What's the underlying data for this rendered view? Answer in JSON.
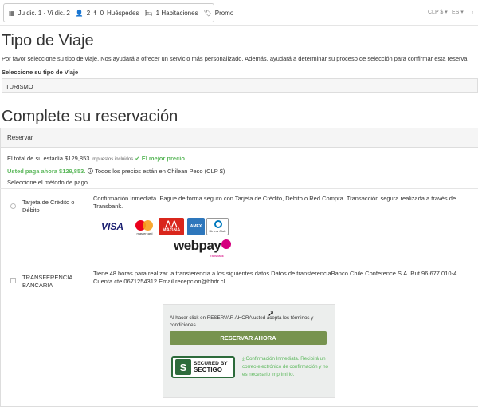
{
  "search": {
    "dates": "Ju dic. 1 - Vi dic. 2",
    "guests": "2",
    "guests_zero": "0",
    "guests_label": "Huéspedes",
    "rooms": "1 Habitaciones",
    "promo": "Promo"
  },
  "header": {
    "currency": "CLP $",
    "language": "ES"
  },
  "trip": {
    "title": "Tipo de Viaje",
    "intro": "Por favor seleccione su tipo de viaje. Nos ayudará a ofrecer un servicio más personalizado. Además, ayudará a determinar su proceso de selección para confirmar esta reserva",
    "select_label": "Seleccione su tipo de Viaje",
    "select_value": "TURISMO"
  },
  "booking": {
    "title": "Complete su reservación",
    "panel_title": "Reservar",
    "total_prefix": "El total de su estadía",
    "total_amount": "$129,853",
    "taxes": "Impuestos incluidos",
    "best_price": "El mejor precio",
    "pay_now": "Usted paga ahora $129,853.",
    "prices_note": "Todos los precios están en Chilean Peso (CLP $)",
    "method_label": "Seleccione el método de pago"
  },
  "payment_methods": [
    {
      "title": "Tarjeta de Crédito o Débito",
      "desc": "Confirmación Inmediata. Pague de forma seguro con Tarjeta de Crédito, Debito o Red Compra. Transacción segura realizada a través de Transbank."
    },
    {
      "title": "TRANSFERENCIA BANCARIA",
      "desc": "Tiene 48 horas para realizar la transferencia a los siguientes datos  Datos de transferenciaBanco Chile  Conference S.A.   Rut 96.677.010-4 Cuenta cte 0671254312  Email recepcion@hbdr.cl"
    }
  ],
  "logos": {
    "visa": "VISA",
    "mastercard": "mastercard",
    "magna": "MAGNA",
    "amex": "AMEX",
    "diners": "Diners Club",
    "webpay": "webpay",
    "webpay_sub": "Transbank"
  },
  "checkout": {
    "terms": "Al hacer click en RESERVAR AHORA usted acepta los términos y condiciones.",
    "button": "RESERVAR AHORA",
    "secured_by": "SECURED BY",
    "sectigo": "SECTIGO",
    "note": "Confirmación Inmediata. Recibirá un correo electrónico de confirmación y no es necesario imprimirlo."
  },
  "colors": {
    "accent_green": "#5cb85c",
    "button_green": "#77934f"
  }
}
